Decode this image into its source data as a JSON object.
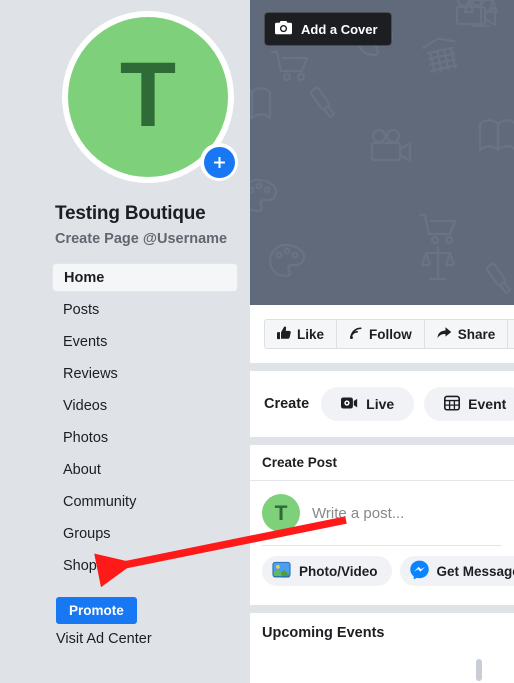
{
  "profile": {
    "avatar_letter": "T",
    "avatar_color": "#7ED07A",
    "avatar_letter_color": "#2f6b36",
    "add_photo_badge": "plus-icon",
    "name": "Testing Boutique",
    "username_prompt": "Create Page @Username"
  },
  "sidebar": {
    "items": [
      {
        "label": "Home",
        "active": true
      },
      {
        "label": "Posts",
        "active": false
      },
      {
        "label": "Events",
        "active": false
      },
      {
        "label": "Reviews",
        "active": false
      },
      {
        "label": "Videos",
        "active": false
      },
      {
        "label": "Photos",
        "active": false
      },
      {
        "label": "About",
        "active": false
      },
      {
        "label": "Community",
        "active": false
      },
      {
        "label": "Groups",
        "active": false
      },
      {
        "label": "Shop",
        "active": false
      }
    ],
    "promote_label": "Promote",
    "promote_color": "#1877F2",
    "ad_center_label": "Visit Ad Center"
  },
  "cover": {
    "add_cover_label": "Add a Cover",
    "add_cover_icon": "camera-icon",
    "background_color": "#606a7b"
  },
  "actions": {
    "buttons": [
      {
        "label": "Like",
        "icon": "thumbs-up-icon"
      },
      {
        "label": "Follow",
        "icon": "rss-follow-icon"
      },
      {
        "label": "Share",
        "icon": "share-arrow-icon"
      },
      {
        "label": "",
        "icon": "ellipsis-icon"
      }
    ]
  },
  "create": {
    "label": "Create",
    "options": [
      {
        "label": "Live",
        "icon": "video-camera-icon"
      },
      {
        "label": "Event",
        "icon": "calendar-icon"
      }
    ]
  },
  "create_post": {
    "header": "Create Post",
    "avatar_letter": "T",
    "placeholder": "Write a post...",
    "actions": [
      {
        "label": "Photo/Video",
        "icon": "photo-video-icon"
      },
      {
        "label": "Get Messages",
        "icon": "messenger-icon"
      }
    ]
  },
  "upcoming_events": {
    "title": "Upcoming Events"
  },
  "annotation": {
    "color": "#FF1A1A",
    "type": "arrow",
    "points_to": "Shop"
  }
}
